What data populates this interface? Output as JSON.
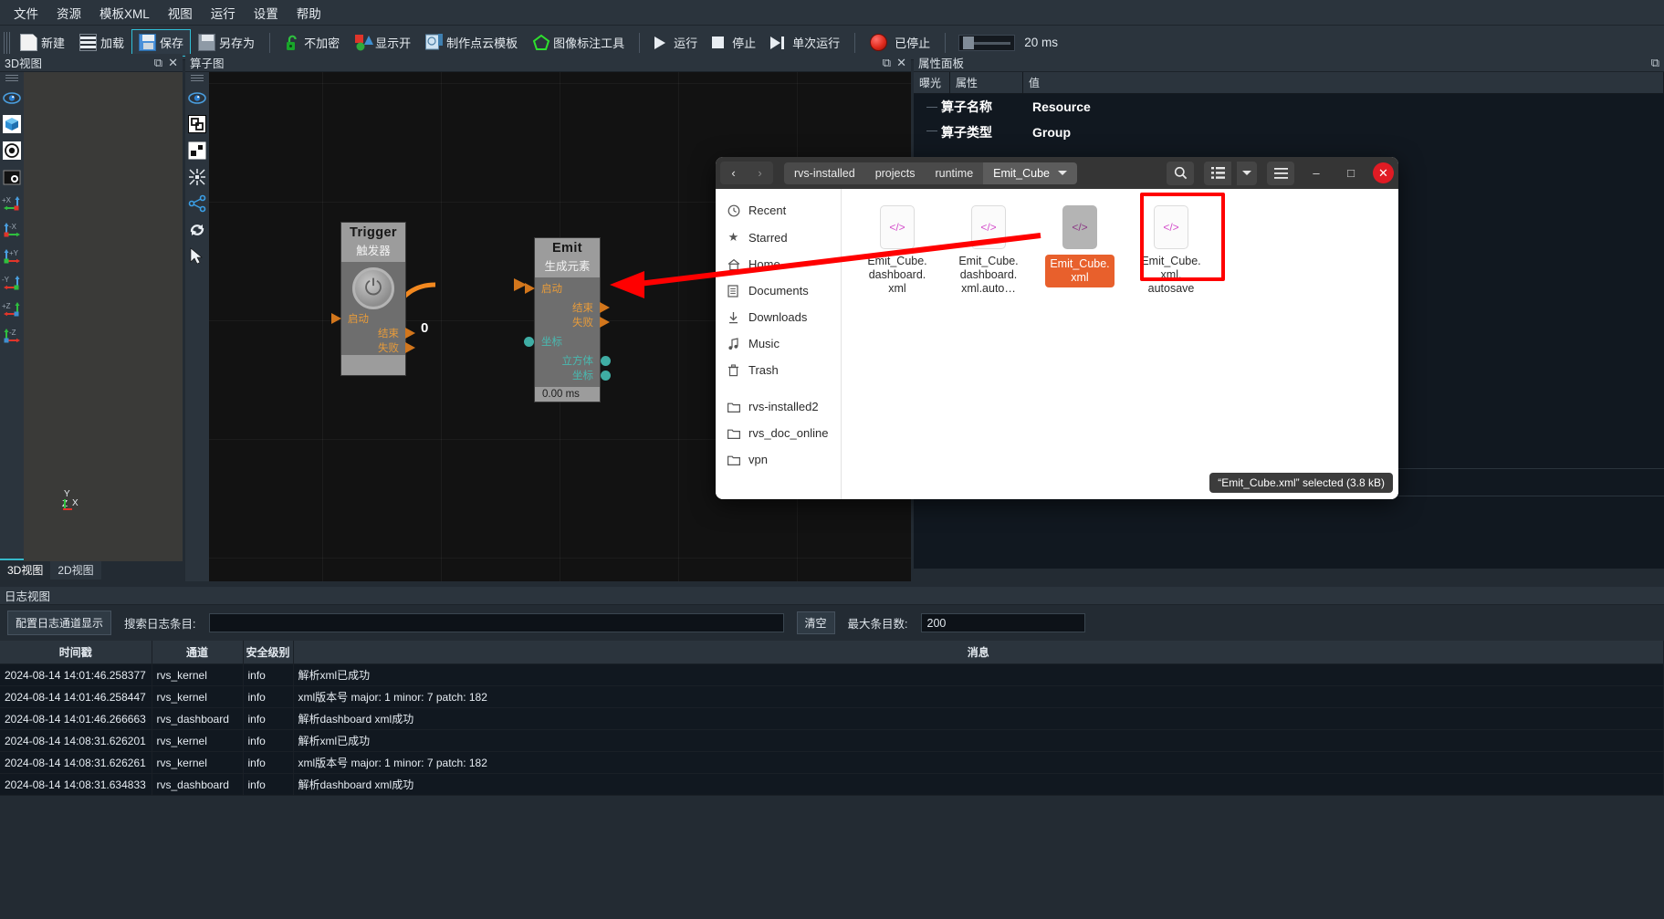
{
  "menubar": {
    "items": [
      {
        "label": "文件",
        "name": "menu-file"
      },
      {
        "label": "资源",
        "name": "menu-resource"
      },
      {
        "label": "模板XML",
        "name": "menu-template-xml"
      },
      {
        "label": "视图",
        "name": "menu-view"
      },
      {
        "label": "运行",
        "name": "menu-run"
      },
      {
        "label": "设置",
        "name": "menu-settings"
      },
      {
        "label": "帮助",
        "name": "menu-help"
      }
    ]
  },
  "toolbar": {
    "new_label": "新建",
    "load_label": "加载",
    "save_label": "保存",
    "saveas_label": "另存为",
    "encrypt_label": "不加密",
    "display_label": "显示开",
    "pointcloud_label": "制作点云模板",
    "annotate_label": "图像标注工具",
    "run_label": "运行",
    "stop_label": "停止",
    "single_run_label": "单次运行",
    "status_label": "已停止",
    "interval_value": "20 ms"
  },
  "view3d": {
    "title": "3D视图",
    "icons": [
      {
        "name": "eye-icon",
        "glyph": "👁"
      },
      {
        "name": "cube-icon",
        "glyph": "◆"
      },
      {
        "name": "target-icon",
        "glyph": "◉"
      },
      {
        "name": "screenshot-icon",
        "glyph": "▣"
      },
      {
        "name": "axis-plus-x-icon",
        "label": "+X"
      },
      {
        "name": "axis-minus-x-icon",
        "label": "-X"
      },
      {
        "name": "axis-plus-y-icon",
        "label": "+Y"
      },
      {
        "name": "axis-minus-y-icon",
        "label": "-Y"
      },
      {
        "name": "axis-plus-z-icon",
        "label": "+Z"
      },
      {
        "name": "axis-minus-z-icon",
        "label": "-Z"
      }
    ],
    "gizmo": {
      "y": "Y",
      "z": "Z",
      "x": "X"
    },
    "tabs": [
      {
        "label": "3D视图",
        "active": true
      },
      {
        "label": "2D视图",
        "active": false
      }
    ]
  },
  "graph": {
    "title": "算子图",
    "tool_icons": [
      {
        "name": "eye-icon"
      },
      {
        "name": "group-select-icon"
      },
      {
        "name": "layout-nodes-icon"
      },
      {
        "name": "collapse-icon"
      },
      {
        "name": "share-nodes-icon"
      },
      {
        "name": "refresh-icon"
      },
      {
        "name": "cursor-icon"
      }
    ],
    "edge_label": "0",
    "nodes": [
      {
        "name_en": "Trigger",
        "name_cn": "触发器",
        "inputs": [
          {
            "label": "启动",
            "type": "flow"
          }
        ],
        "outputs": [
          {
            "label": "结束",
            "type": "flow"
          },
          {
            "label": "失败",
            "type": "flow"
          }
        ],
        "data_inputs": [],
        "data_outputs": [],
        "footer": ""
      },
      {
        "name_en": "Emit",
        "name_cn": "生成元素",
        "inputs": [
          {
            "label": "启动",
            "type": "flow"
          }
        ],
        "outputs": [
          {
            "label": "结束",
            "type": "flow"
          },
          {
            "label": "失败",
            "type": "flow"
          }
        ],
        "data_inputs": [
          {
            "label": "坐标",
            "type": "data"
          }
        ],
        "data_outputs": [
          {
            "label": "立方体",
            "type": "data"
          },
          {
            "label": "坐标",
            "type": "data"
          }
        ],
        "footer": "0.00 ms"
      }
    ]
  },
  "properties": {
    "title": "属性面板",
    "columns": [
      "曝光",
      "属性",
      "值"
    ],
    "rows": [
      {
        "key": "算子名称",
        "value": "Resource"
      },
      {
        "key": "算子类型",
        "value": "Group"
      }
    ]
  },
  "filedialog": {
    "nav_back": "‹",
    "nav_forward": "›",
    "breadcrumbs": [
      {
        "label": "rvs-installed",
        "active": false
      },
      {
        "label": "projects",
        "active": false
      },
      {
        "label": "runtime",
        "active": false
      },
      {
        "label": "Emit_Cube",
        "active": true
      }
    ],
    "header_buttons": [
      {
        "name": "search-icon",
        "glyph": "🔍"
      },
      {
        "name": "list-view-icon",
        "glyph": "☰"
      },
      {
        "name": "view-options-chevron-icon",
        "glyph": "▾"
      },
      {
        "name": "hamburger-menu-icon",
        "glyph": "≡"
      }
    ],
    "window_buttons": [
      {
        "name": "minimize-button",
        "glyph": "–"
      },
      {
        "name": "maximize-button",
        "glyph": "□"
      },
      {
        "name": "close-button",
        "glyph": "✕"
      }
    ],
    "places": [
      {
        "label": "Recent",
        "icon": "clock-icon",
        "glyph": "🕐"
      },
      {
        "label": "Starred",
        "icon": "star-icon",
        "glyph": "★"
      },
      {
        "label": "Home",
        "icon": "home-icon",
        "glyph": "⌂"
      },
      {
        "label": "Documents",
        "icon": "documents-icon",
        "glyph": "🗎"
      },
      {
        "label": "Downloads",
        "icon": "downloads-icon",
        "glyph": "⤓"
      },
      {
        "label": "Music",
        "icon": "music-icon",
        "glyph": "♪"
      },
      {
        "label": "Trash",
        "icon": "trash-icon",
        "glyph": "🗑"
      },
      {
        "label": "rvs-installed2",
        "icon": "folder-icon",
        "glyph": "🗀"
      },
      {
        "label": "rvs_doc_online",
        "icon": "folder-icon",
        "glyph": "🗀"
      },
      {
        "label": "vpn",
        "icon": "folder-icon",
        "glyph": "🗀"
      }
    ],
    "files": [
      {
        "name": "Emit_Cube.\ndashboard.\nxml",
        "icon": "code-file-icon",
        "glyph": "</>",
        "selected": false
      },
      {
        "name": "Emit_Cube.\ndashboard.\nxml.auto…",
        "icon": "code-file-icon",
        "glyph": "</>",
        "selected": false
      },
      {
        "name": "Emit_Cube.\nxml",
        "icon": "code-file-icon",
        "glyph": "</>",
        "selected": true
      },
      {
        "name": "Emit_Cube.\nxml.\nautosave",
        "icon": "code-file-icon",
        "glyph": "</>",
        "selected": false
      }
    ],
    "status": "“Emit_Cube.xml” selected  (3.8 kB)"
  },
  "logview": {
    "title": "日志视图",
    "config_button": "配置日志通道显示",
    "search_label": "搜索日志条目:",
    "search_value": "",
    "clear_button": "清空",
    "max_label": "最大条目数:",
    "max_value": "200",
    "columns": [
      "时间戳",
      "通道",
      "安全级别",
      "消息"
    ],
    "rows": [
      [
        "2024-08-14 14:01:46.258377",
        "rvs_kernel",
        "info",
        "解析xml已成功"
      ],
      [
        "2024-08-14 14:01:46.258447",
        "rvs_kernel",
        "info",
        "xml版本号 major: 1  minor: 7  patch: 182"
      ],
      [
        "2024-08-14 14:01:46.266663",
        "rvs_dashboard",
        "info",
        "解析dashboard xml成功"
      ],
      [
        "2024-08-14 14:08:31.626201",
        "rvs_kernel",
        "info",
        "解析xml已成功"
      ],
      [
        "2024-08-14 14:08:31.626261",
        "rvs_kernel",
        "info",
        "xml版本号 major: 1  minor: 7  patch: 182"
      ],
      [
        "2024-08-14 14:08:31.634833",
        "rvs_dashboard",
        "info",
        "解析dashboard xml成功"
      ]
    ]
  },
  "colors": {
    "accent": "#35b8c9",
    "selection_orange": "#e8602c",
    "annotation_red": "#ff0000",
    "flow_port": "#d2761c",
    "data_port": "#3fada4"
  }
}
